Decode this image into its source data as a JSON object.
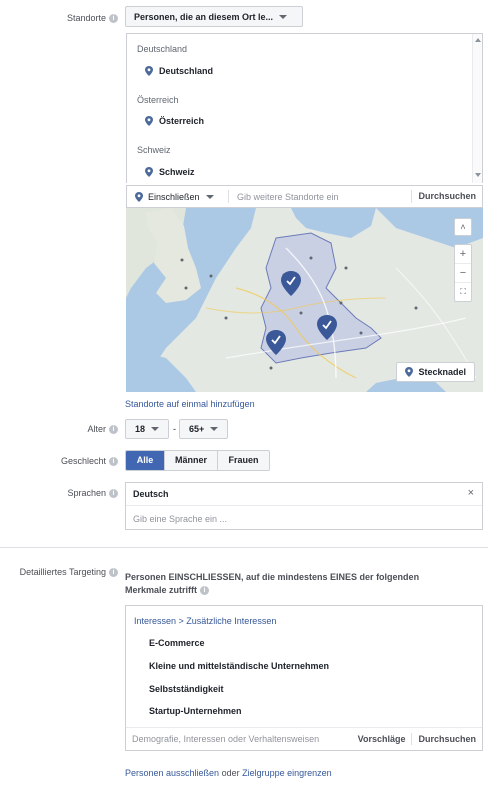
{
  "locations": {
    "label": "Standorte",
    "type_select": "Personen, die an diesem Ort le...",
    "groups": [
      {
        "header": "Deutschland",
        "item": "Deutschland"
      },
      {
        "header": "Österreich",
        "item": "Österreich"
      },
      {
        "header": "Schweiz",
        "item": "Schweiz"
      }
    ],
    "include_select": "Einschließen",
    "search_placeholder": "Gib weitere Standorte ein",
    "browse": "Durchsuchen",
    "map_button": "Stecknadel",
    "bulk_link": "Standorte auf einmal hinzufügen"
  },
  "age": {
    "label": "Alter",
    "min": "18",
    "separator": "-",
    "max": "65+"
  },
  "gender": {
    "label": "Geschlecht",
    "options": [
      "Alle",
      "Männer",
      "Frauen"
    ],
    "selected": "Alle"
  },
  "languages": {
    "label": "Sprachen",
    "token": "Deutsch",
    "remove": "×",
    "placeholder": "Gib eine Sprache ein ..."
  },
  "detailed": {
    "label": "Detailliertes Targeting",
    "description": "Personen EINSCHLIESSEN, auf die mindestens EINES der folgenden Merkmale zutrifft",
    "breadcrumb": "Interessen > Zusätzliche Interessen",
    "items": [
      "E-Commerce",
      "Kleine und mittelständische Unternehmen",
      "Selbstständigkeit",
      "Startup-Unternehmen"
    ],
    "search_placeholder": "Demografie, Interessen oder Verhaltensweisen",
    "suggestions": "Vorschläge",
    "browse": "Durchsuchen",
    "footer_link1": "Personen ausschließen",
    "footer_oder": "oder",
    "footer_link2": "Zielgruppe eingrenzen"
  },
  "colors": {
    "accent": "#4267b2",
    "link": "#365899",
    "pin": "#4b6a9b"
  }
}
